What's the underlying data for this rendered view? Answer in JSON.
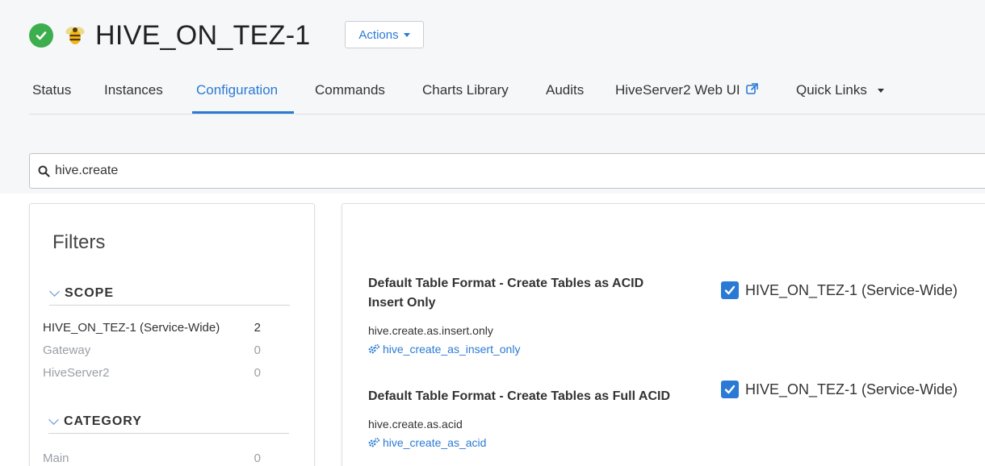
{
  "header": {
    "title": "HIVE_ON_TEZ-1",
    "status_icon": "check-circle-icon",
    "status_color": "#3cae4e",
    "service_icon": "hive-bee-icon",
    "actions_label": "Actions"
  },
  "tabs": [
    {
      "label": "Status"
    },
    {
      "label": "Instances"
    },
    {
      "label": "Configuration",
      "active": true
    },
    {
      "label": "Commands"
    },
    {
      "label": "Charts Library"
    },
    {
      "label": "Audits"
    },
    {
      "label": "HiveServer2 Web UI"
    },
    {
      "label": "Quick Links"
    }
  ],
  "search": {
    "value": "hive.create"
  },
  "filters": {
    "title": "Filters",
    "scope": {
      "heading": "SCOPE",
      "items": [
        {
          "label": "HIVE_ON_TEZ-1 (Service-Wide)",
          "count": "2"
        },
        {
          "label": "Gateway",
          "count": "0"
        },
        {
          "label": "HiveServer2",
          "count": "0"
        }
      ]
    },
    "category": {
      "heading": "CATEGORY",
      "items": [
        {
          "label": "Main",
          "count": "0"
        }
      ]
    }
  },
  "properties": [
    {
      "name_line1": "Default Table Format - Create Tables as ACID",
      "name_line2": "Insert Only",
      "key": "hive.create.as.insert.only",
      "link": "hive_create_as_insert_only",
      "value_label": "HIVE_ON_TEZ-1 (Service-Wide)",
      "checked": true
    },
    {
      "name_line1": "Default Table Format - Create Tables as Full ACID",
      "key": "hive.create.as.acid",
      "link": "hive_create_as_acid",
      "value_label": "HIVE_ON_TEZ-1 (Service-Wide)",
      "checked": true
    }
  ],
  "colors": {
    "accent": "#2a7ad5",
    "success": "#3cae4e"
  }
}
